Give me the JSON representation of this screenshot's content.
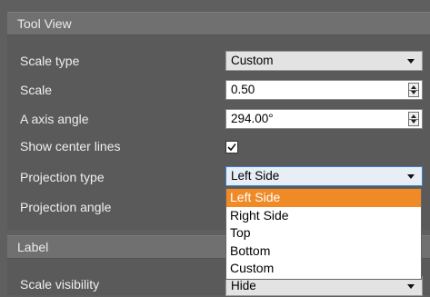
{
  "tool_view": {
    "header": "Tool View",
    "scale_type": {
      "label": "Scale type",
      "value": "Custom"
    },
    "scale": {
      "label": "Scale",
      "value": "0.50"
    },
    "a_axis_angle": {
      "label": "A axis angle",
      "value": "294.00°"
    },
    "show_center_lines": {
      "label": "Show center lines",
      "checked": true
    },
    "projection_type": {
      "label": "Projection type",
      "value": "Left Side",
      "options": [
        "Left Side",
        "Right Side",
        "Top",
        "Bottom",
        "Custom"
      ],
      "highlighted": "Left Side"
    },
    "projection_angle": {
      "label": "Projection angle"
    }
  },
  "label_section": {
    "header": "Label",
    "scale_visibility": {
      "label": "Scale visibility",
      "value": "Hide"
    }
  },
  "colors": {
    "highlight": "#ef8a26",
    "focus_border": "#3c7fd0"
  }
}
